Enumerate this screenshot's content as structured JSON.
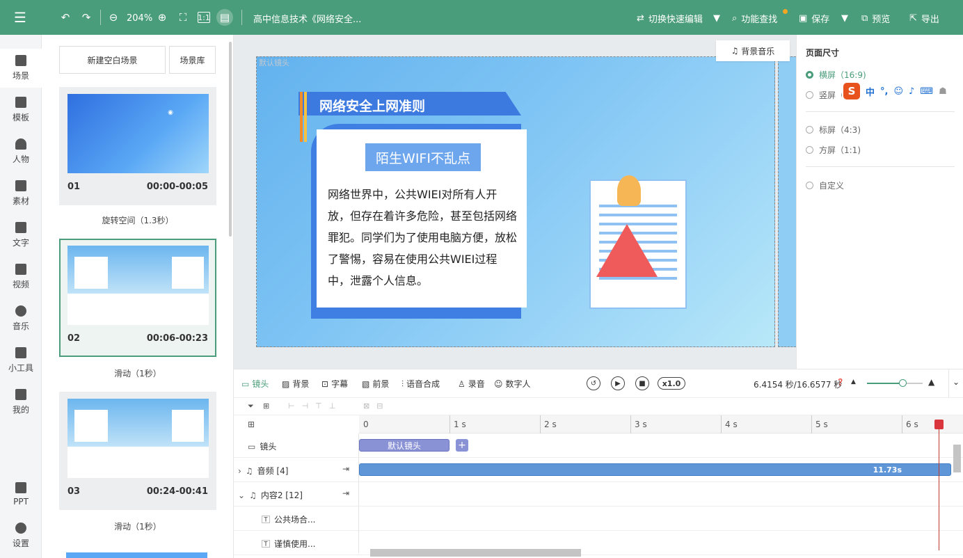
{
  "topbar": {
    "zoom": "204%",
    "doc_title": "高中信息技术《网络安全...",
    "switch_edit": "切换快速编辑",
    "find": "功能查找",
    "save": "保存",
    "preview": "预览",
    "export": "导出"
  },
  "leftnav": [
    {
      "label": "场景",
      "icon": "scene-icon"
    },
    {
      "label": "模板",
      "icon": "template-icon"
    },
    {
      "label": "人物",
      "icon": "person-icon"
    },
    {
      "label": "素材",
      "icon": "material-icon"
    },
    {
      "label": "文字",
      "icon": "text-icon"
    },
    {
      "label": "视频",
      "icon": "video-icon"
    },
    {
      "label": "音乐",
      "icon": "music-icon"
    },
    {
      "label": "小工具",
      "icon": "toolbox-icon"
    },
    {
      "label": "我的",
      "icon": "upload-icon"
    },
    {
      "label": "PPT",
      "icon": "ppt-icon"
    },
    {
      "label": "设置",
      "icon": "gear-icon"
    }
  ],
  "scenes": {
    "new_blank": "新建空白场景",
    "library": "场景库",
    "items": [
      {
        "num": "01",
        "time": "00:00-00:05",
        "transition": "旋转空间（1.3秒）"
      },
      {
        "num": "02",
        "time": "00:06-00:23",
        "transition": "滑动（1秒）"
      },
      {
        "num": "03",
        "time": "00:24-00:41",
        "transition": "滑动（1秒）"
      }
    ]
  },
  "stage": {
    "label": "默认镜头",
    "bg_music": "背景音乐",
    "heading": "网络安全上网准则",
    "subheading": "陌生WIFI不乱点",
    "body": "网络世界中，公共WIEI对所有人开放，但存在着许多危险，甚至包括网络罪犯。同学们为了使用电脑方便，放松了警惕，容易在使用公共WIEI过程中，泄露个人信息。"
  },
  "right_panel": {
    "title": "页面尺寸",
    "options": [
      "横屏（16:9)",
      "竖屏（9",
      "标屏（4:3)",
      "方屏（1:1)",
      "自定义"
    ],
    "ime_lang": "中"
  },
  "timeline": {
    "tabs": [
      "镜头",
      "背景",
      "字幕",
      "前景",
      "语音合成",
      "录音",
      "数字人"
    ],
    "speed": "x1.0",
    "time": "6.4154 秒/16.6577 秒",
    "ruler": [
      "0",
      "1 s",
      "2 s",
      "3 s",
      "4 s",
      "5 s",
      "6 s"
    ],
    "rows": {
      "camera": "镜头",
      "camera_clip": "默认镜头",
      "audio": "音频 [4]",
      "audio_clip": "11.73s",
      "content": "内容2 [12]",
      "item1": "公共场合...",
      "item2": "谨慎使用..."
    }
  },
  "colors": {
    "brand": "#4a9d7a",
    "playhead": "#d9363e",
    "clip_camera": "#8a92d6",
    "clip_audio": "#5f96d8"
  }
}
